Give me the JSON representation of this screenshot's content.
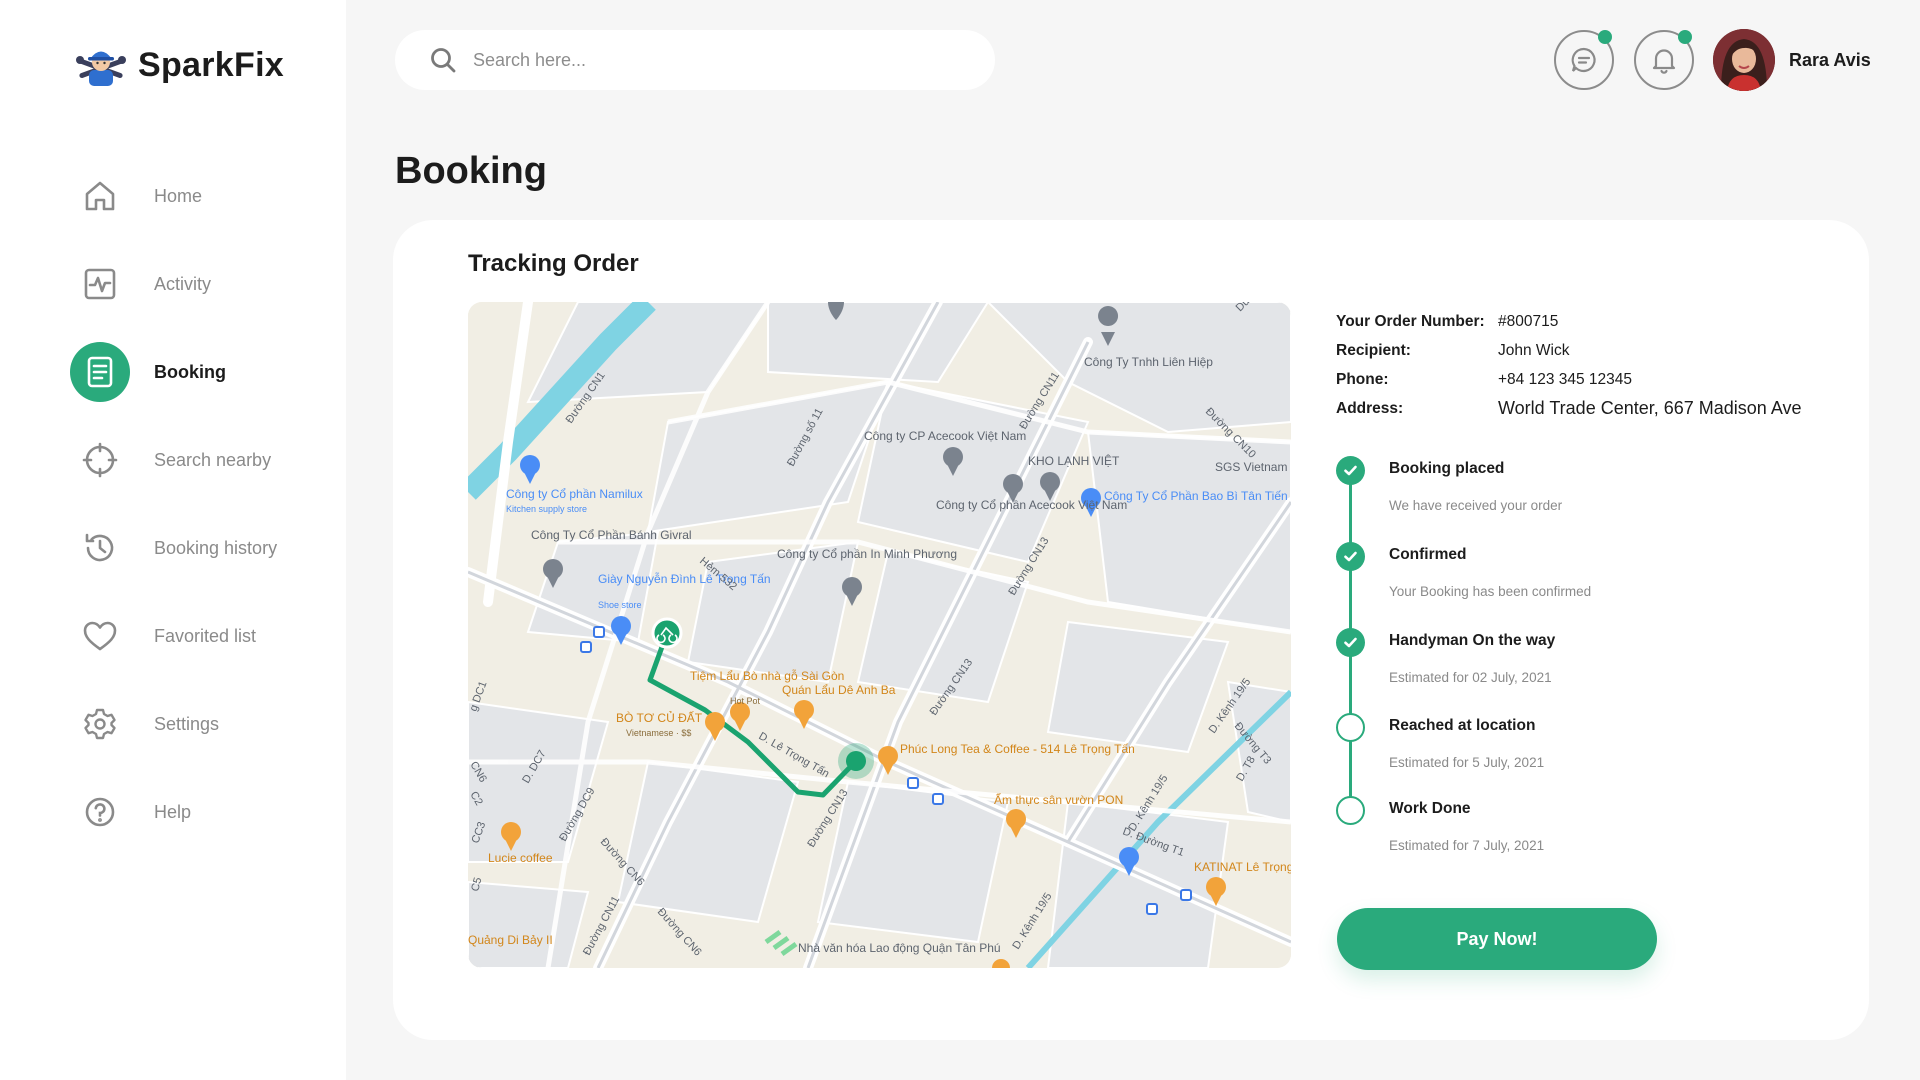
{
  "brand": {
    "name": "SparkFix"
  },
  "sidebar": {
    "items": [
      {
        "label": "Home",
        "icon": "home-icon",
        "active": false
      },
      {
        "label": "Activity",
        "icon": "activity-icon",
        "active": false
      },
      {
        "label": "Booking",
        "icon": "document-icon",
        "active": true
      },
      {
        "label": "Search nearby",
        "icon": "crosshair-icon",
        "active": false
      },
      {
        "label": "Booking history",
        "icon": "history-icon",
        "active": false
      },
      {
        "label": "Favorited list",
        "icon": "heart-icon",
        "active": false
      },
      {
        "label": "Settings",
        "icon": "gear-icon",
        "active": false
      },
      {
        "label": "Help",
        "icon": "help-icon",
        "active": false
      }
    ]
  },
  "header": {
    "search_placeholder": "Search here...",
    "user_name": "Rara Avis",
    "messages_has_notification": true,
    "notifications_has_notification": true
  },
  "page": {
    "title": "Booking"
  },
  "tracking": {
    "title": "Tracking Order",
    "order": {
      "number_label": "Your Order Number:",
      "number": "#800715",
      "recipient_label": "Recipient:",
      "recipient": "John Wick",
      "phone_label": "Phone:",
      "phone": "+84 123 345 12345",
      "address_label": "Address:",
      "address": "World Trade Center, 667 Madison Ave"
    },
    "steps": [
      {
        "title": "Booking placed",
        "subtitle": "We have received your order",
        "done": true
      },
      {
        "title": "Confirmed",
        "subtitle": "Your Booking has been confirmed",
        "done": true
      },
      {
        "title": "Handyman On the way",
        "subtitle": "Estimated for 02 July, 2021",
        "done": true
      },
      {
        "title": "Reached at location",
        "subtitle": "Estimated for 5 July, 2021",
        "done": false
      },
      {
        "title": "Work Done",
        "subtitle": "Estimated for 7 July, 2021",
        "done": false
      }
    ],
    "pay_button": "Pay Now!"
  },
  "map": {
    "labels": {
      "l1": "Công ty Cổ phần Namilux",
      "l2": "Kitchen supply store",
      "l3": "Công Ty Cổ Phần Bánh Givral",
      "l4": "Giày Nguyễn Đình Lê Trọng Tấn",
      "l5": "Shoe store",
      "l6": "Công ty CP Acecook Việt Nam",
      "l7": "Công ty Cổ phần Acecook Việt Nam",
      "l8": "KHO LẠNH VIỆT",
      "l9": "Công Ty Cổ Phần Bao Bì Tân Tiến",
      "l10": "Công Ty Tnhh Liên Hiệp",
      "l11": "SGS Vietnam",
      "l12": "Công ty Cổ phần In Minh Phương",
      "l13": "Tiệm Lẩu Bò nhà gỗ Sài Gòn",
      "l14": "Hot Pot",
      "l15": "BÒ TƠ CỦ ĐẤT",
      "l16": "Vietnamese · $$",
      "l17": "Quán Lẩu Dê Anh Ba",
      "l18": "Phúc Long Tea & Coffee - 514 Lê Trọng Tấn",
      "l19": "Ẩm thực sân vườn PON",
      "l20": "Lucie coffee",
      "l21": "KATINAT Lê Trọng",
      "l22": "Nhà văn hóa Lao động Quận Tân Phú",
      "l23": "Quảng Di Bảy II",
      "r1": "Đường CN1",
      "r2": "Đường số 11",
      "r3": "Đường CN11",
      "r4": "Đường CN10",
      "r5": "Đường CN13",
      "r6": "Đường CN13",
      "r7": "Hẻm 532",
      "r8": "D. Lê Trọng Tấn",
      "r9": "Đường CN13",
      "r10": "D. Kênh 19/5",
      "r11": "Đường T3",
      "r12": "D. T8",
      "r13": "D. Kênh 19/5",
      "r14": "D. Đường T1",
      "r15": "Đường DC9",
      "r16": "Đường CN6",
      "r17": "Đường CN11",
      "r18": "Đường CN6",
      "r19": "D. DC7",
      "r20": "D. Kênh 19/5",
      "r21": "Du",
      "r22": "CN6",
      "r23": "g DC1",
      "r24": "CC3",
      "r25": "C2",
      "r26": "C5"
    }
  }
}
